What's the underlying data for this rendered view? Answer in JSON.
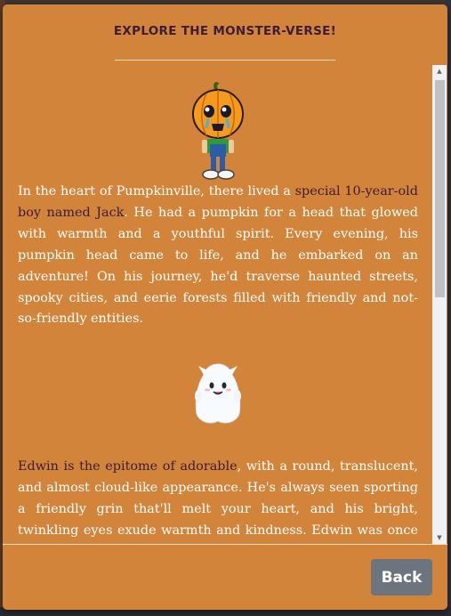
{
  "modal": {
    "title": "EXPLORE THE MONSTER-VERSE!",
    "back_label": "Back"
  },
  "stories": [
    {
      "image_icon": "pumpkin-boy",
      "highlight": "special 10-year-old boy named Jack",
      "before": "In the heart of Pumpkinville, there lived a ",
      "after": ". He had a pumpkin for a head that glowed with warmth and a youthful spirit. Every evening, his pumpkin head came to life, and he embarked on an adventure! On his journey, he'd traverse haunted streets, spooky cities, and eerie forests filled with friendly and not-so-friendly entities."
    },
    {
      "image_icon": "ghost",
      "highlight": "Edwin is the epitome of adorable",
      "before": "",
      "after": ", with a round, translucent, and almost cloud-like appearance. He's always seen sporting a friendly grin that'll melt your heart, and his bright, twinkling eyes exude warmth and kindness. Edwin was once a mischievous ghost who just"
    }
  ],
  "colors": {
    "modal_bg": "#d1843a",
    "highlight_text": "#3b1c3a",
    "body_text": "#ffffff",
    "back_button": "#6c757d"
  }
}
